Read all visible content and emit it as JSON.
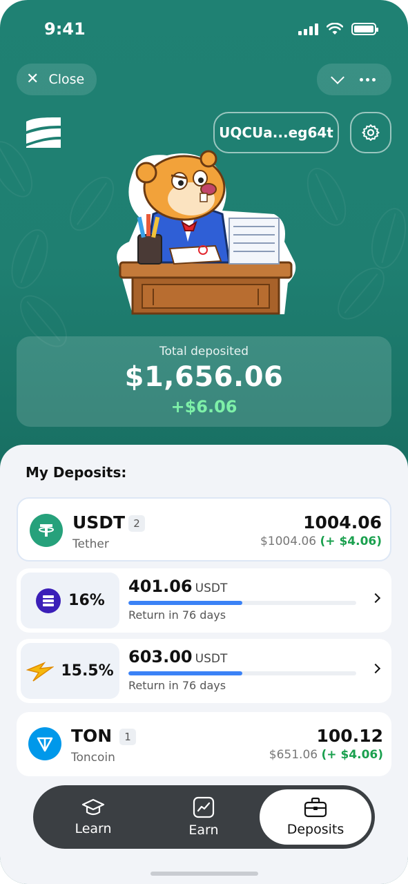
{
  "status_bar": {
    "time": "9:41"
  },
  "header": {
    "close_label": "Close",
    "wallet_address": "UQCUa...eg64t"
  },
  "summary": {
    "label": "Total deposited",
    "value": "$1,656.06",
    "gain": "+$6.06"
  },
  "deposits": {
    "title": "My Deposits:",
    "assets": [
      {
        "ticker": "USDT",
        "count": "2",
        "name": "Tether",
        "amount": "1004.06",
        "fiat": "$1004.06",
        "gain": "(+ $4.06)",
        "color": "#26a17b"
      },
      {
        "ticker": "TON",
        "count": "1",
        "name": "Toncoin",
        "amount": "100.12",
        "fiat": "$651.06",
        "gain": "(+ $4.06)",
        "color": "#0098ea"
      }
    ],
    "positions": [
      {
        "rate": "16%",
        "amount": "401.06",
        "unit": "USDT",
        "progress": 0.5,
        "return_text": "Return in 76 days",
        "icon": "ethena-icon"
      },
      {
        "rate": "15.5%",
        "amount": "603.00",
        "unit": "USDT",
        "progress": 0.5,
        "return_text": "Return in 76 days",
        "icon": "lightning-icon"
      }
    ]
  },
  "tabs": [
    {
      "label": "Learn",
      "icon": "graduation-cap-icon"
    },
    {
      "label": "Earn",
      "icon": "chart-icon"
    },
    {
      "label": "Deposits",
      "icon": "briefcase-icon",
      "active": true
    }
  ],
  "colors": {
    "header_bg": "#1f8173",
    "gain_green": "#1aa04e",
    "summary_gain": "#7ef0a8",
    "progress_blue": "#3b82f6",
    "tabbar_bg": "#3b3f43"
  }
}
